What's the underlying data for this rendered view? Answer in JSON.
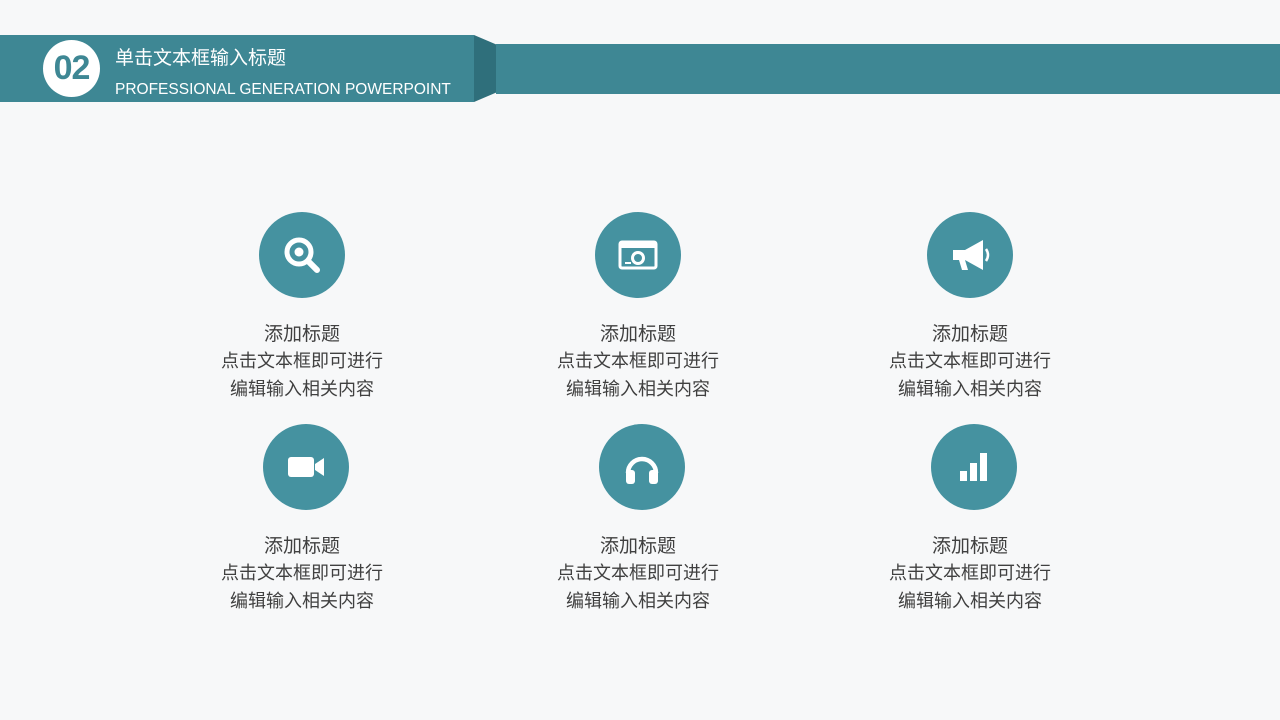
{
  "header": {
    "number": "02",
    "title": "单击文本框输入标题",
    "subtitle": "PROFESSIONAL GENERATION POWERPOINT"
  },
  "colors": {
    "accent": "#3e8794",
    "accent_dark": "#2f6f7b",
    "icon_circle": "#4592a0",
    "background": "#f7f8f9",
    "text": "#404040"
  },
  "items": [
    {
      "icon": "search-icon",
      "title": "添加标题",
      "line1": "点击文本框即可进行",
      "line2": "编辑输入相关内容"
    },
    {
      "icon": "browser-window-icon",
      "title": "添加标题",
      "line1": "点击文本框即可进行",
      "line2": "编辑输入相关内容"
    },
    {
      "icon": "megaphone-icon",
      "title": "添加标题",
      "line1": "点击文本框即可进行",
      "line2": "编辑输入相关内容"
    },
    {
      "icon": "video-camera-icon",
      "title": "添加标题",
      "line1": "点击文本框即可进行",
      "line2": "编辑输入相关内容"
    },
    {
      "icon": "headphones-icon",
      "title": "添加标题",
      "line1": "点击文本框即可进行",
      "line2": "编辑输入相关内容"
    },
    {
      "icon": "bar-chart-icon",
      "title": "添加标题",
      "line1": "点击文本框即可进行",
      "line2": "编辑输入相关内容"
    }
  ]
}
